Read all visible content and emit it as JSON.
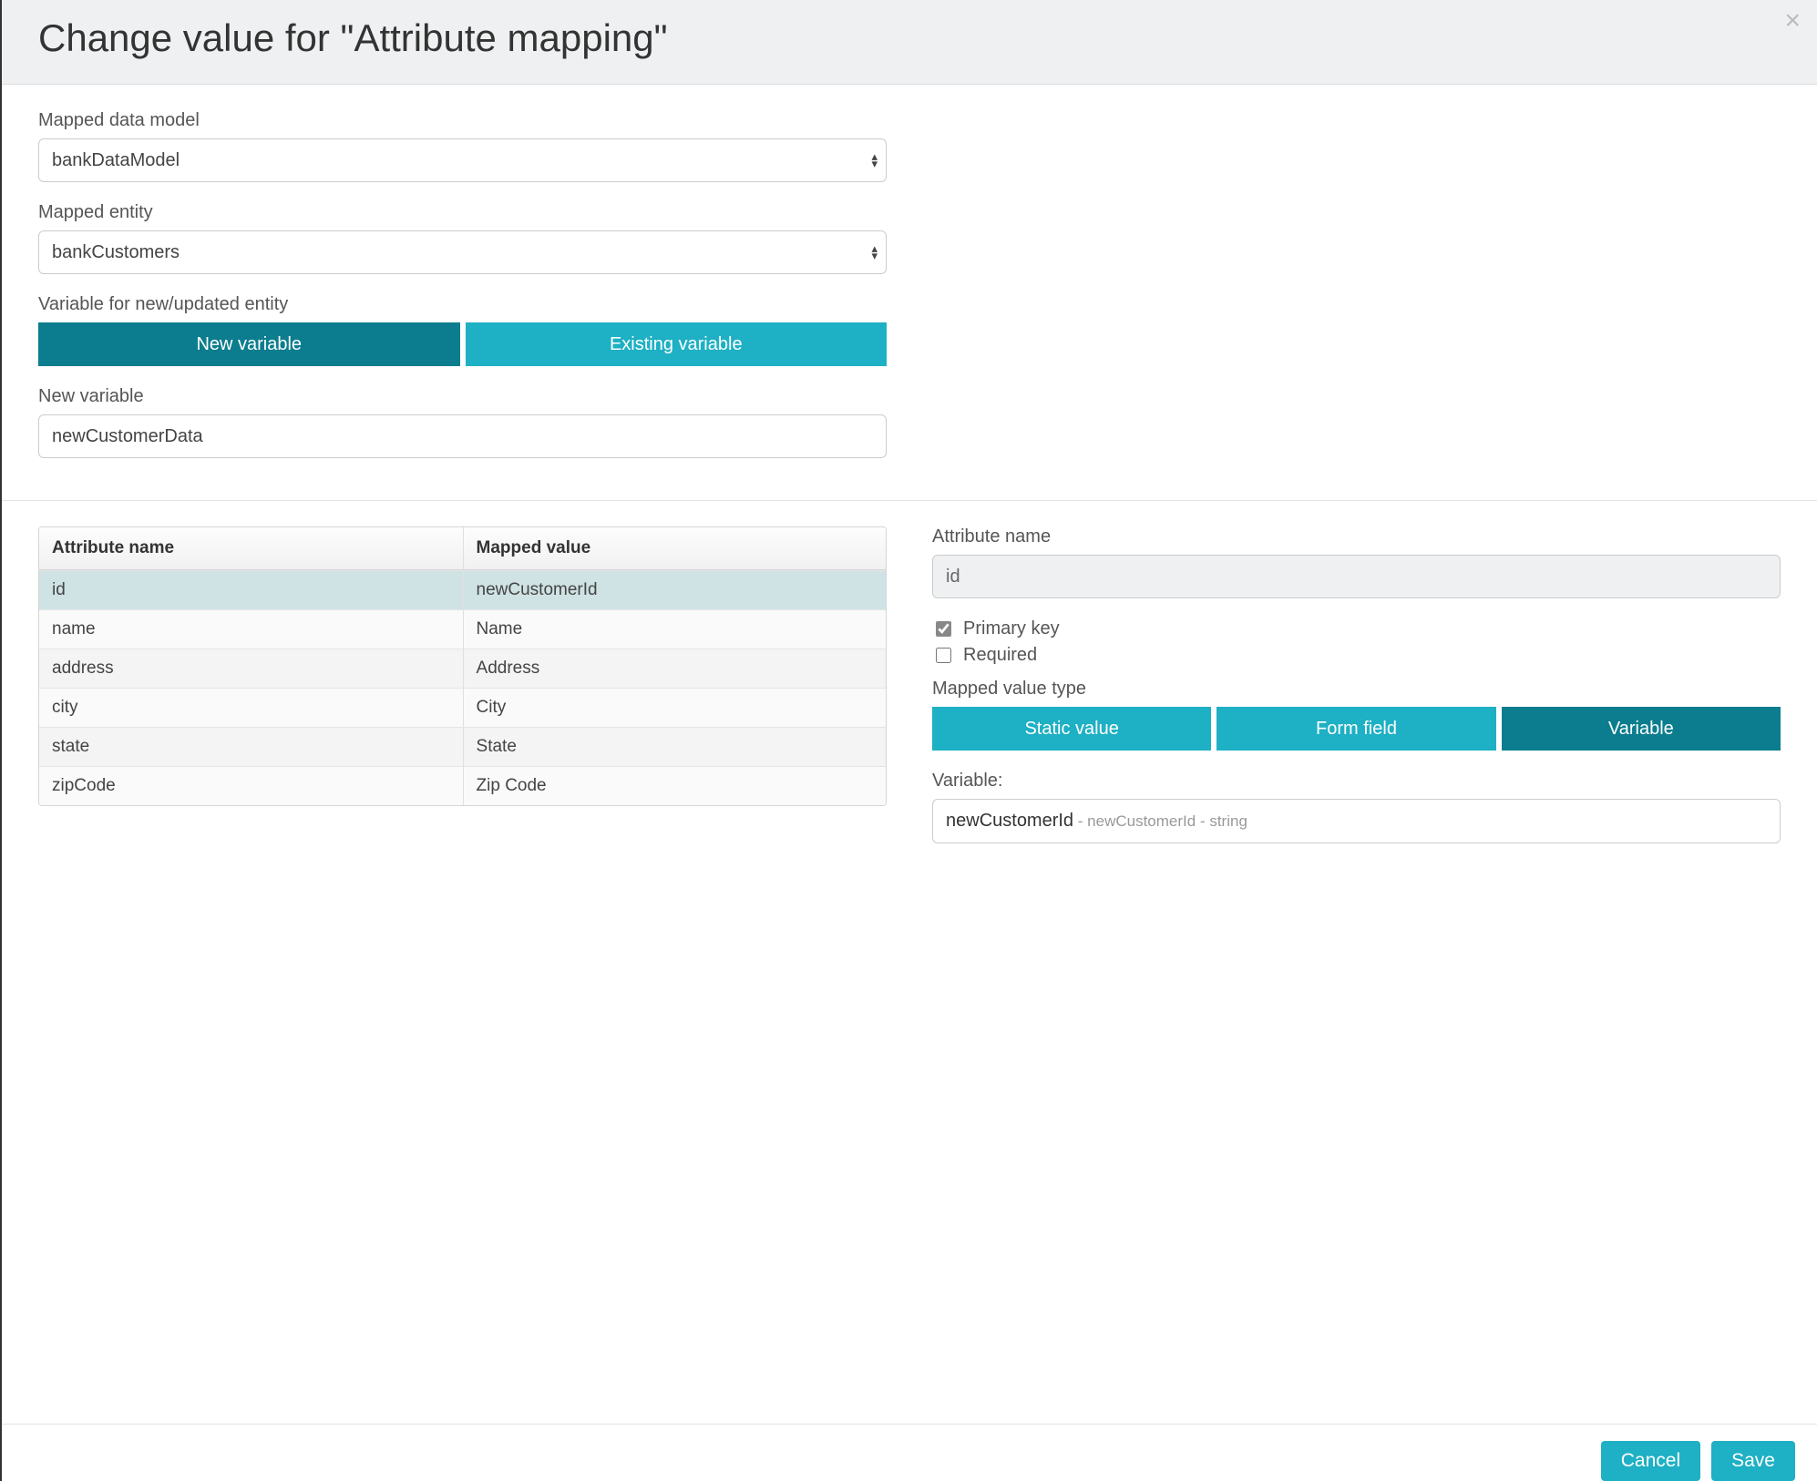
{
  "header": {
    "title": "Change value for \"Attribute mapping\"",
    "close_icon": "×"
  },
  "form": {
    "mapped_model_label": "Mapped data model",
    "mapped_model_value": "bankDataModel",
    "mapped_entity_label": "Mapped entity",
    "mapped_entity_value": "bankCustomers",
    "var_mode_label": "Variable for new/updated entity",
    "var_mode_new": "New variable",
    "var_mode_existing": "Existing variable",
    "new_var_label": "New variable",
    "new_var_value": "newCustomerData"
  },
  "table": {
    "col_attr": "Attribute name",
    "col_mapped": "Mapped value",
    "rows": [
      {
        "attr": "id",
        "mapped": "newCustomerId",
        "selected": true
      },
      {
        "attr": "name",
        "mapped": "Name",
        "selected": false
      },
      {
        "attr": "address",
        "mapped": "Address",
        "selected": false
      },
      {
        "attr": "city",
        "mapped": "City",
        "selected": false
      },
      {
        "attr": "state",
        "mapped": "State",
        "selected": false
      },
      {
        "attr": "zipCode",
        "mapped": "Zip Code",
        "selected": false
      }
    ]
  },
  "detail": {
    "attr_name_label": "Attribute name",
    "attr_name_value": "id",
    "primary_key_label": "Primary key",
    "primary_key_checked": true,
    "required_label": "Required",
    "required_checked": false,
    "mapped_type_label": "Mapped value type",
    "type_static": "Static value",
    "type_form": "Form field",
    "type_variable": "Variable",
    "variable_label": "Variable:",
    "variable_name": "newCustomerId",
    "variable_meta": " - newCustomerId - string"
  },
  "footer": {
    "cancel": "Cancel",
    "save": "Save"
  }
}
